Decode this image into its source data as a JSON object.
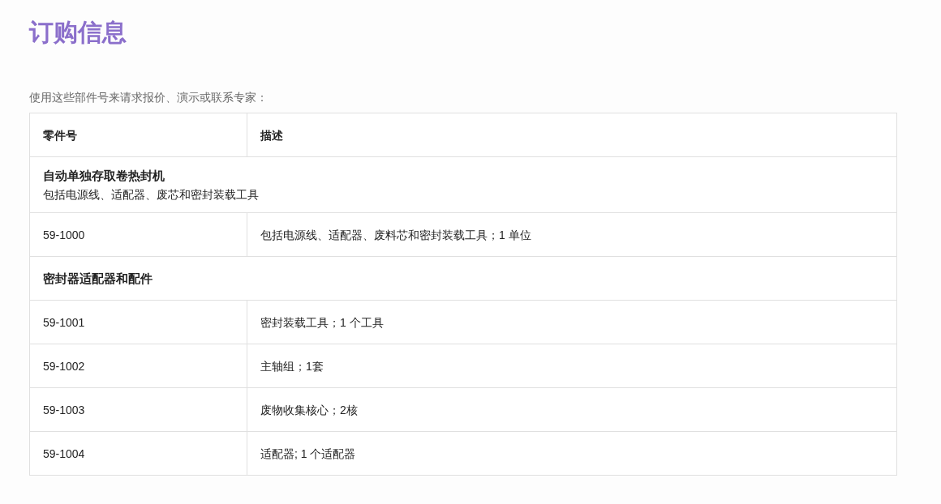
{
  "title": "订购信息",
  "intro": "使用这些部件号来请求报价、演示或联系专家：",
  "table": {
    "columns": [
      "零件号",
      "描述"
    ],
    "rows": [
      {
        "kind": "group",
        "title": "自动单独存取卷热封机",
        "subtitle": "包括电源线、适配器、废芯和密封装载工具"
      },
      {
        "kind": "part",
        "part": "59-1000",
        "description": "包括电源线、适配器、废料芯和密封装载工具；1 单位"
      },
      {
        "kind": "group",
        "title": "密封器适配器和配件"
      },
      {
        "kind": "part",
        "part": "59-1001",
        "description": "密封装载工具；1 个工具"
      },
      {
        "kind": "part",
        "part": "59-1002",
        "description": "主轴组；1套"
      },
      {
        "kind": "part",
        "part": "59-1003",
        "description": "废物收集核心；2核"
      },
      {
        "kind": "part",
        "part": "59-1004",
        "description": "适配器; 1 个适配器"
      }
    ]
  }
}
